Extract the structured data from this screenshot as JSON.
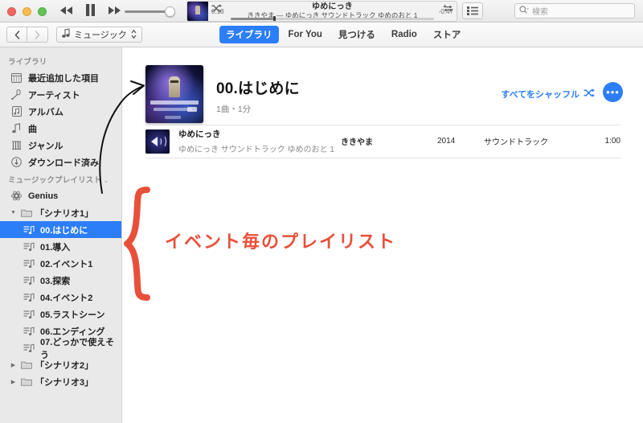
{
  "window": {
    "traffic_lights": [
      "close",
      "minimize",
      "maximize"
    ]
  },
  "player": {
    "rewind_icon": "rewind-icon",
    "pause_icon": "pause-icon",
    "fastforward_icon": "fastforward-icon",
    "volume_icon": "volume-slider",
    "shuffle_icon": "shuffle-icon",
    "repeat_icon": "repeat-icon",
    "track_title": "ゆめにっき",
    "track_subtitle": "ききやま — ゆめにっき サウンドトラック ゆめのおと 1",
    "elapsed": "0:13",
    "remaining": "-0:47",
    "progress_percent": 21,
    "artwork_name": "album-artwork"
  },
  "toolbar": {
    "list_view_icon": "list-view-icon",
    "search": {
      "icon": "search-icon",
      "placeholder": "検索",
      "value": ""
    }
  },
  "navbar": {
    "back_icon": "chevron-left-icon",
    "forward_icon": "chevron-right-icon",
    "kind_selector": {
      "icon": "music-note-icon",
      "label": "ミュージック",
      "chevron": "updown-chevron-icon"
    },
    "tabs": [
      {
        "label": "ライブラリ",
        "active": true
      },
      {
        "label": "For You",
        "active": false
      },
      {
        "label": "見つける",
        "active": false
      },
      {
        "label": "Radio",
        "active": false
      },
      {
        "label": "ストア",
        "active": false
      }
    ]
  },
  "sidebar": {
    "library_header": "ライブラリ",
    "library_items": [
      {
        "icon": "recently-added-icon",
        "label": "最近追加した項目"
      },
      {
        "icon": "artist-microphone-icon",
        "label": "アーティスト"
      },
      {
        "icon": "album-icon",
        "label": "アルバム"
      },
      {
        "icon": "song-note-icon",
        "label": "曲"
      },
      {
        "icon": "genre-icon",
        "label": "ジャンル"
      },
      {
        "icon": "downloaded-icon",
        "label": "ダウンロード済み"
      }
    ],
    "playlists_header": "ミュージックプレイリスト",
    "playlists_header_caret": "chevron-down-icon",
    "genius": {
      "icon": "genius-icon",
      "label": "Genius"
    },
    "folders": [
      {
        "icon": "folder-icon",
        "label": "「シナリオ1」",
        "expanded": true,
        "children": [
          {
            "icon": "playlist-icon",
            "label": "00.はじめに",
            "selected": true
          },
          {
            "icon": "playlist-icon",
            "label": "01.導入",
            "selected": false
          },
          {
            "icon": "playlist-icon",
            "label": "02.イベント1",
            "selected": false
          },
          {
            "icon": "playlist-icon",
            "label": "03.探索",
            "selected": false
          },
          {
            "icon": "playlist-icon",
            "label": "04.イベント2",
            "selected": false
          },
          {
            "icon": "playlist-icon",
            "label": "05.ラストシーン",
            "selected": false
          },
          {
            "icon": "playlist-icon",
            "label": "06.エンディング",
            "selected": false
          },
          {
            "icon": "playlist-icon",
            "label": "07.どっかで使えそう",
            "selected": false
          }
        ]
      },
      {
        "icon": "folder-icon",
        "label": "「シナリオ2」",
        "expanded": false,
        "children": []
      },
      {
        "icon": "folder-icon",
        "label": "「シナリオ3」",
        "expanded": false,
        "children": []
      }
    ]
  },
  "main": {
    "album": {
      "artwork_name": "playlist-artwork",
      "title": "00.はじめに",
      "subtitle": "1曲・1分"
    },
    "shuffle_all": {
      "label": "すべてをシャッフル",
      "icon": "shuffle-icon"
    },
    "more_button": {
      "icon": "ellipsis-icon",
      "glyph": "•••"
    },
    "track": {
      "artwork_name": "track-artwork",
      "title": "ゆめにっき",
      "album": "ゆめにっき サウンドトラック ゆめのおと 1",
      "artist": "ききやま",
      "year": "2014",
      "genre": "サウンドトラック",
      "duration": "1:00"
    }
  },
  "annotations": {
    "callout_text": "イベント毎のプレイリスト",
    "callout_color": "#e8503a",
    "brace_name": "red-brace",
    "arrow_name": "black-curved-arrow"
  }
}
